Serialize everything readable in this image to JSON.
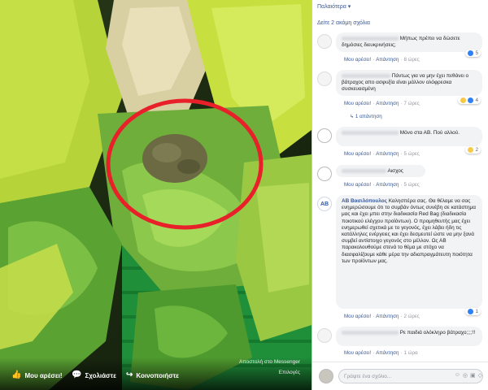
{
  "photo": {
    "actions": {
      "like_label": "Μου αρέσει!",
      "comment_label": "Σχολιάστε",
      "share_label": "Κοινοποιήστε"
    },
    "send_messenger": "Αποστολή στο Messenger",
    "options": "Επιλογές",
    "highlight_color": "#e8202a"
  },
  "panel": {
    "older_label": "Παλαιότερα ▾",
    "more_comments": "Δείτε 2 ακόμη σχόλια",
    "comments": [
      {
        "text": "Μήπως πρέπει να δώσετε δημόσιες διευκρινήσεις;",
        "like": "Μου αρέσει!",
        "reply": "Απάντηση",
        "time": "8 ώρες",
        "reaction_count": "5"
      },
      {
        "text": "Πάντως για να μην έχει πεθάνει ο βάτραχος απο ασφυξία είναι μάλλον ολόφρεσκα συσκευασμένη",
        "like": "Μου αρέσει!",
        "reply": "Απάντηση",
        "time": "7 ώρες",
        "reaction_count": "4",
        "replies_link": "1 απάντηση"
      },
      {
        "text": "Μόνο στα ΑΒ. Πού αλλού.",
        "like": "Μου αρέσει!",
        "reply": "Απάντηση",
        "time": "5 ώρες",
        "reaction_count": "2"
      },
      {
        "text": "Αισχος",
        "like": "Μου αρέσει!",
        "reply": "Απάντηση",
        "time": "5 ώρες"
      },
      {
        "author": "ΑΒ Βασιλόπουλος",
        "text": "Καλησπέρα σας. Θα θέλαμε να σας ενημερώσουμε ότι το συμβάν όντως συνέβη σε κατάστημα μας και έχει μπει στην διαδικασία Red Bag (διαδικασία ποιοτικού ελέγχου προϊόντων). Ο προμηθευτής μας έχει ενημερωθεί σχετικά με το γεγονός, έχει λάβει ήδη τις κατάλληλες ενέργειες και έχει δεσμευτεί ώστε να μην ξανά συμβεί αντίστοιχο γεγονός στο μέλλον. Ως ΑΒ παρακολουθούμε στενά το θέμα με στόχο να διασφαλίζουμε κάθε μέρα την αδιαπραγμάτευτη ποιότητα των προϊόντων μας.",
        "avatar": "ΑΒ",
        "like": "Μου αρέσει!",
        "reply": "Απάντηση",
        "time": "2 ώρες",
        "reaction_count": "1"
      },
      {
        "text": "Ρε παιδιά ολόκληρο βάτραχο;;;;!!",
        "like": "Μου αρέσει!",
        "reply": "Απάντηση",
        "time": "1 ώρα"
      }
    ],
    "composer_placeholder": "Γράψτε ένα σχόλιο...",
    "link_color": "#385898"
  }
}
